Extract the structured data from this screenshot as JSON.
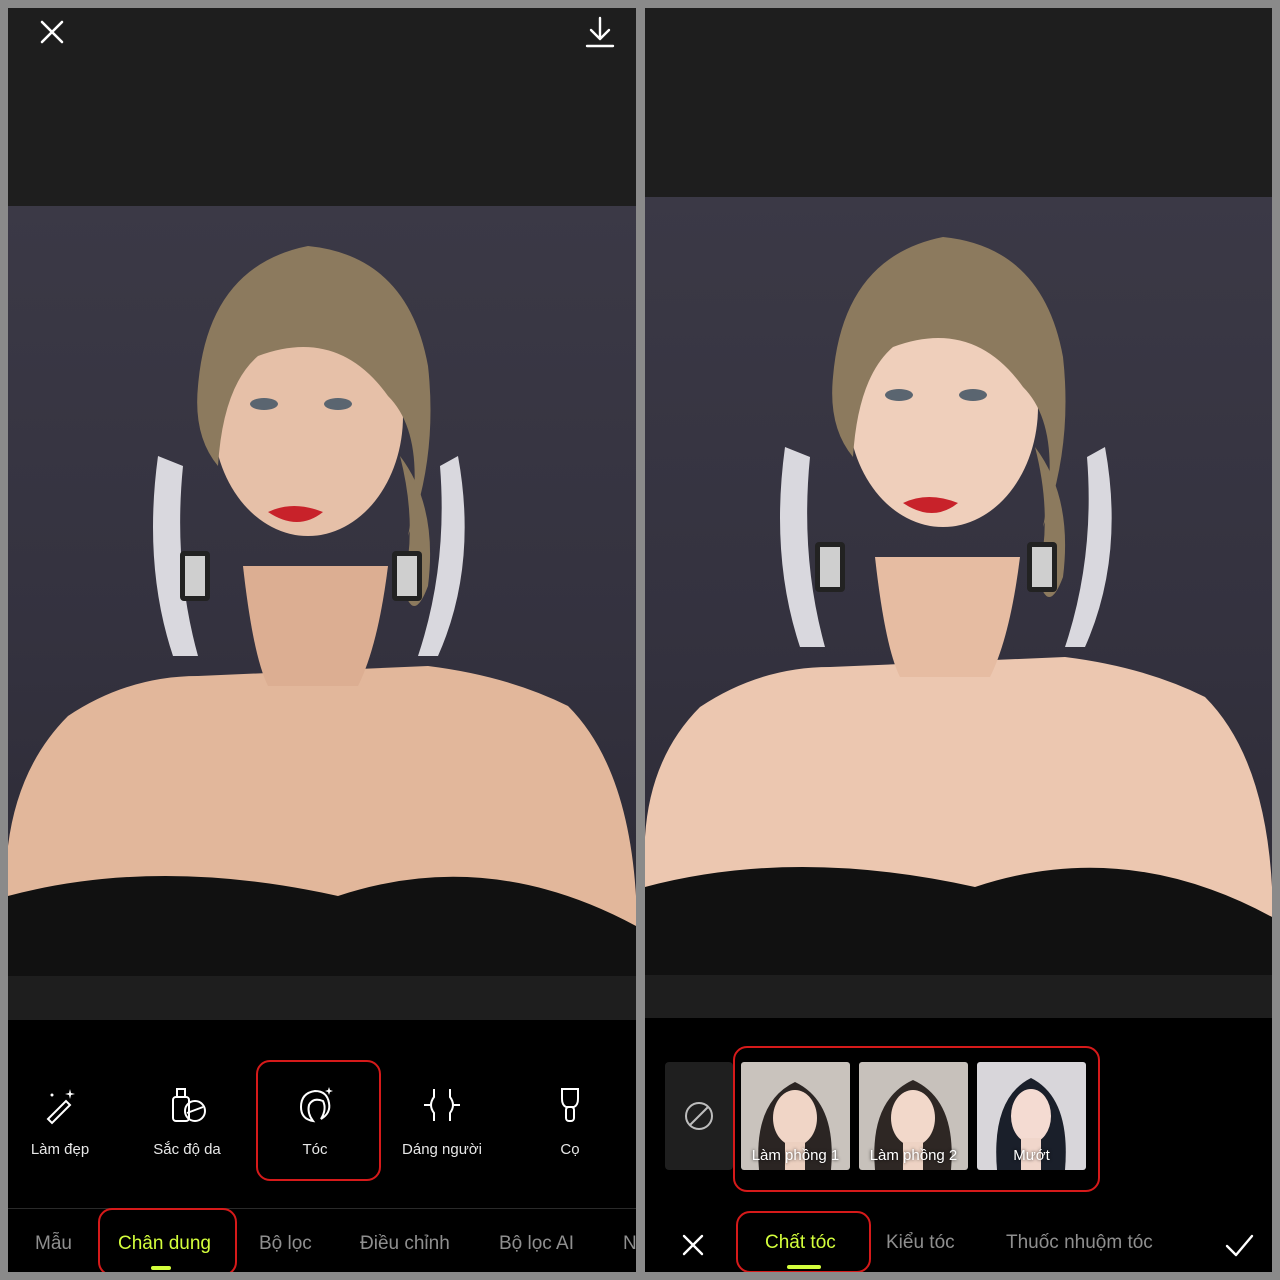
{
  "left": {
    "tools": [
      {
        "label": "Làm đẹp",
        "icon": "magic-wand-icon"
      },
      {
        "label": "Sắc độ da",
        "icon": "skin-tone-icon"
      },
      {
        "label": "Tóc",
        "icon": "hair-icon"
      },
      {
        "label": "Dáng người",
        "icon": "body-shape-icon"
      },
      {
        "label": "Cọ",
        "icon": "brush-icon"
      }
    ],
    "tabs": [
      {
        "label": "Mẫu"
      },
      {
        "label": "Chân dung",
        "active": true
      },
      {
        "label": "Bộ lọc"
      },
      {
        "label": "Điều chỉnh"
      },
      {
        "label": "Bộ lọc AI"
      },
      {
        "label": "N"
      }
    ]
  },
  "right": {
    "hair_options": [
      {
        "label": "Làm phồng 1"
      },
      {
        "label": "Làm phồng 2"
      },
      {
        "label": "Mướt"
      }
    ],
    "tabs": [
      {
        "label": "Chất tóc",
        "active": true
      },
      {
        "label": "Kiểu tóc"
      },
      {
        "label": "Thuốc nhuộm tóc"
      }
    ]
  },
  "colors": {
    "accent": "#d4ff3c",
    "highlight": "#d61a1a",
    "panel": "#1e1e1e",
    "sheet": "#000000"
  }
}
